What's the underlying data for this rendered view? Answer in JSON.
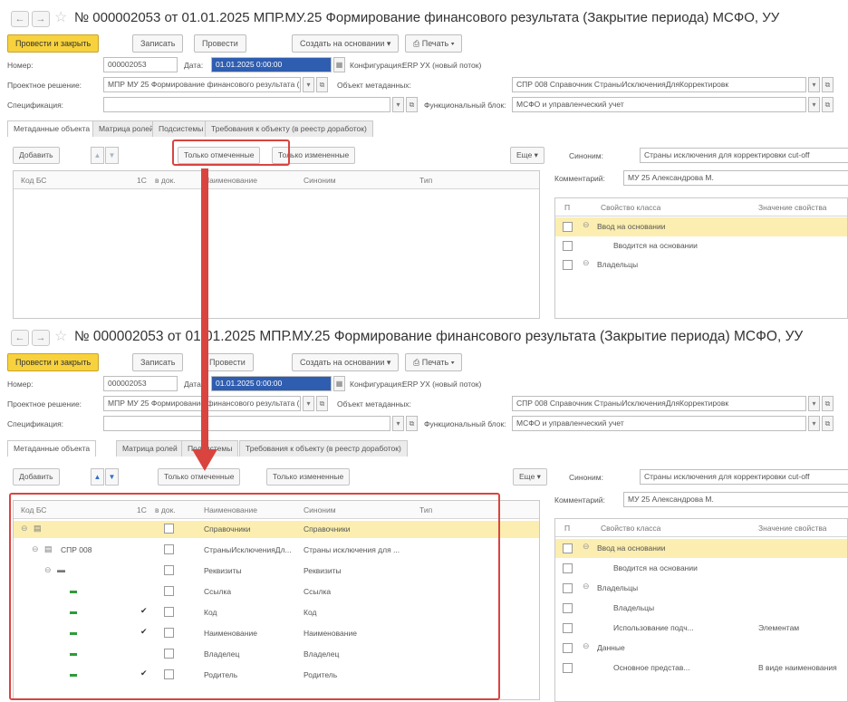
{
  "doc_title": "№ 000002053 от 01.01.2025 МПР.МУ.25 Формирование финансового результата (Закрытие периода) МСФО, УУ",
  "toolbar": {
    "post_close": "Провести и закрыть",
    "save": "Записать",
    "post": "Провести",
    "create_based": "Создать на основании",
    "print": "Печать"
  },
  "form": {
    "number_label": "Номер:",
    "number_value": "000002053",
    "date_label": "Дата:",
    "date_value": "01.01.2025 0:00:00",
    "config_label": "Конфигурация:",
    "config_value": "ERP УХ (новый поток)",
    "project_label": "Проектное решение:",
    "project_value": "МПР МУ 25 Формирование финансового результата (Закры",
    "meta_label": "Объект метаданных:",
    "meta_value": "СПР 008 Справочник СтраныИсключенияДляКорректировк",
    "spec_label": "Спецификация:",
    "spec_value": "",
    "flow_label": "Функциональный блок:",
    "flow_value": "МСФО и управленческий учет"
  },
  "tabs": [
    "Метаданные объекта",
    "Матрица ролей",
    "Подсистемы",
    "Требования к объекту (в реестр доработок)"
  ],
  "subbar": {
    "add": "Добавить",
    "only_checked": "Только отмеченные",
    "only_changed": "Только измененные",
    "more": "Еще",
    "synonym_label": "Синоним:",
    "synonym_value": "Страны исключения для корректировки cut-off",
    "comment_label": "Комментарий:",
    "comment_value": "МУ 25 Александрова М."
  },
  "grid_headers": [
    "Код БС",
    "1С",
    "в док.",
    "Наименование",
    "Синоним",
    "Тип"
  ],
  "grid_rows": [
    {
      "code": "",
      "name": "Справочники",
      "synonym": "Справочники",
      "checked": false
    },
    {
      "code": "СПР 008",
      "name": "СтраныИсключенияДл...",
      "synonym": "Страны исключения для ...",
      "checked": false
    },
    {
      "code": "",
      "name": "Реквизиты",
      "synonym": "Реквизиты",
      "checked": false
    },
    {
      "code": "",
      "name": "Ссылка",
      "synonym": "Ссылка",
      "checked": false
    },
    {
      "code": "",
      "name": "Код",
      "synonym": "Код",
      "checked": true
    },
    {
      "code": "",
      "name": "Наименование",
      "synonym": "Наименование",
      "checked": true
    },
    {
      "code": "",
      "name": "Владелец",
      "synonym": "Владелец",
      "checked": false
    },
    {
      "code": "",
      "name": "Родитель",
      "synonym": "Родитель",
      "checked": true
    }
  ],
  "prop_headers": [
    "П",
    "Свойство класса",
    "Значение свойства"
  ],
  "prop_rows_top": [
    {
      "name": "Ввод на основании",
      "value": ""
    },
    {
      "name": "Вводится на основании",
      "value": ""
    },
    {
      "name": "Владельцы",
      "value": ""
    }
  ],
  "prop_rows_bottom": [
    {
      "name": "Ввод на основании",
      "value": ""
    },
    {
      "name": "Вводится на основании",
      "value": ""
    },
    {
      "name": "Владельцы",
      "value": ""
    },
    {
      "name": "Владельцы",
      "value": ""
    },
    {
      "name": "Использование подч...",
      "value": "Элементам"
    },
    {
      "name": "Данные",
      "value": ""
    },
    {
      "name": "Основное представ...",
      "value": "В виде наименования"
    }
  ],
  "colors": {
    "accent": "#f7d23e",
    "highlight": "#fbeeb0",
    "selection": "#2f5db0",
    "annotation": "#d9443f"
  }
}
